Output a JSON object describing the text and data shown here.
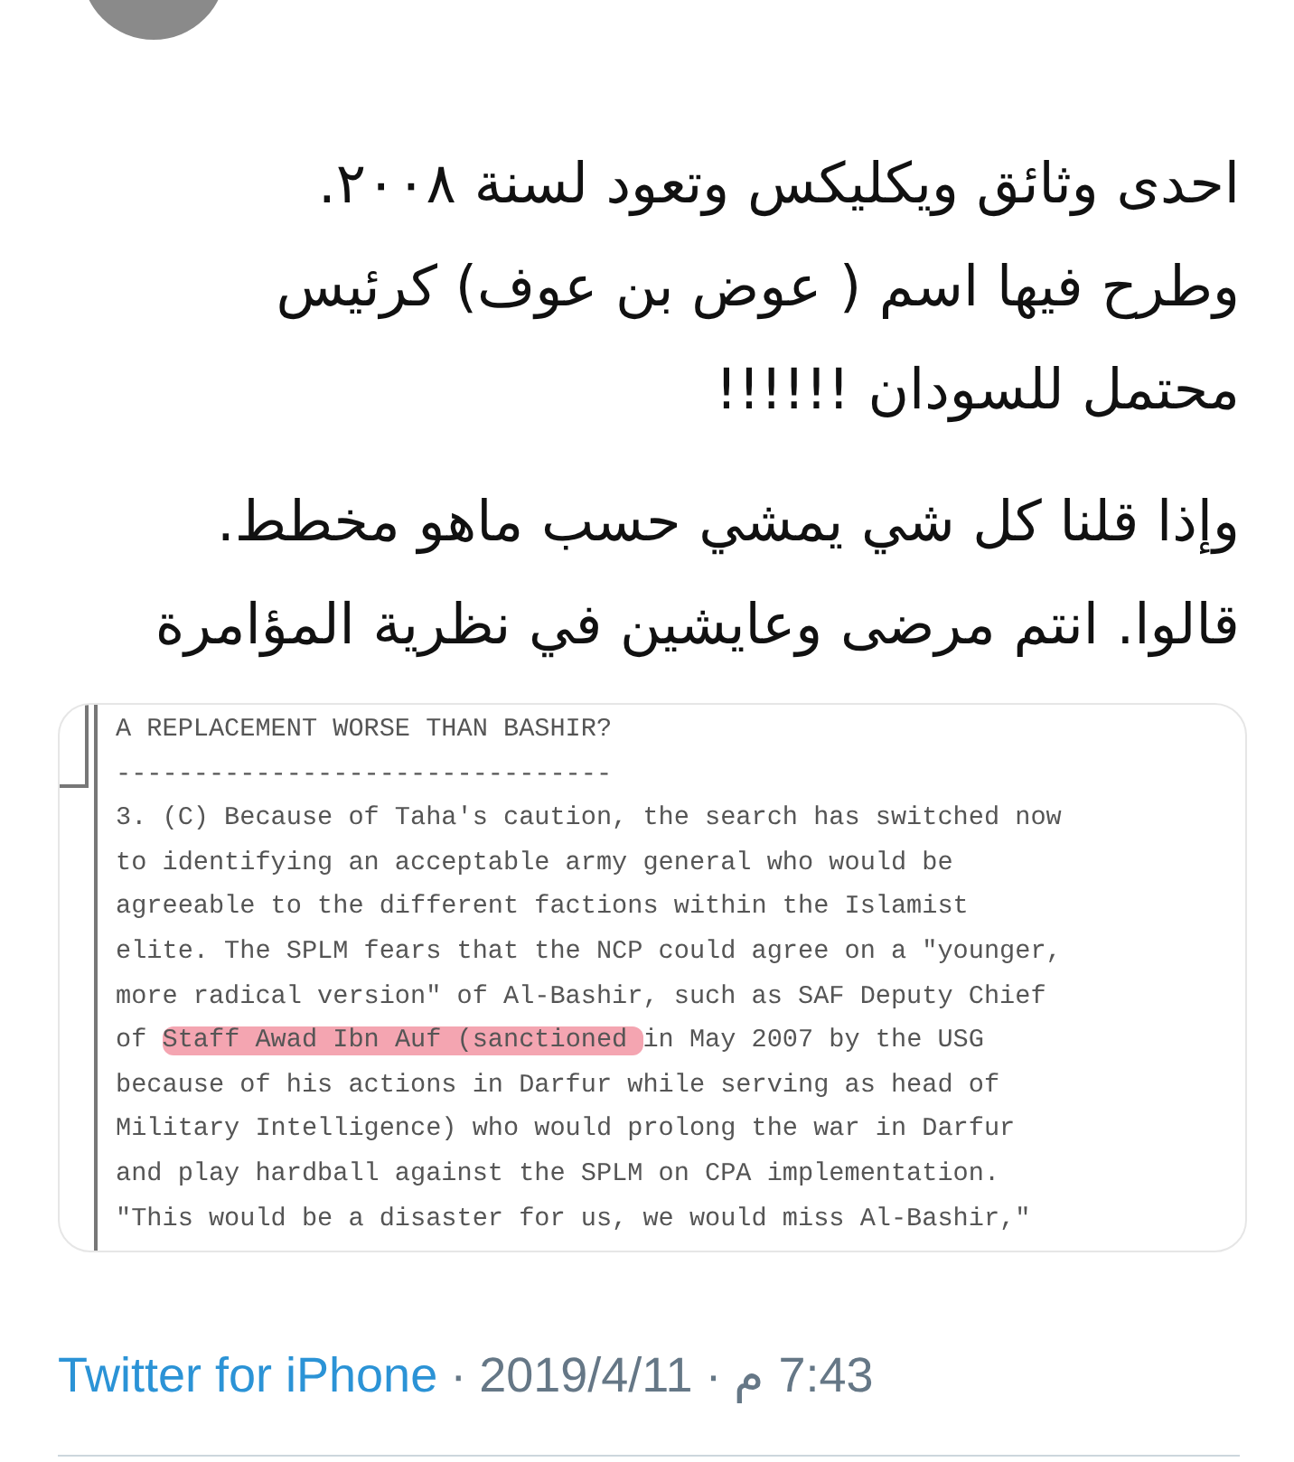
{
  "tweet": {
    "paragraphs": [
      [
        "احدى وثائق ويكليكس وتعود لسنة ٢٠٠٨.",
        "وطرح فيها اسم ( عوض بن عوف) كرئيس",
        "محتمل للسودان !!!!!!"
      ],
      [
        "وإذا قلنا كل شي يمشي حسب ماهو مخطط.",
        "قالوا. انتم مرضى وعايشين في نظرية المؤامرة"
      ]
    ]
  },
  "document": {
    "lines": [
      [
        {
          "text": "A REPLACEMENT WORSE THAN BASHIR?",
          "highlighted": false
        }
      ],
      [
        {
          "text": "--------------------------------",
          "highlighted": false
        }
      ],
      [
        {
          "text": "3. (C) Because of Taha's caution, the search has switched now",
          "highlighted": false
        }
      ],
      [
        {
          "text": "to identifying an acceptable army general who would be",
          "highlighted": false
        }
      ],
      [
        {
          "text": "agreeable to the different factions within the Islamist",
          "highlighted": false
        }
      ],
      [
        {
          "text": "elite. The SPLM fears that the NCP could agree on a \"younger,",
          "highlighted": false
        }
      ],
      [
        {
          "text": "more radical version\" of Al-Bashir, such as SAF Deputy Chief",
          "highlighted": false
        }
      ],
      [
        {
          "text": "of ",
          "highlighted": false
        },
        {
          "text": "Staff Awad Ibn Auf (sanctioned ",
          "highlighted": true
        },
        {
          "text": "in May 2007 by the USG",
          "highlighted": false
        }
      ],
      [
        {
          "text": "because of his actions in Darfur while serving as head of",
          "highlighted": false
        }
      ],
      [
        {
          "text": "Military Intelligence) who would prolong the war in Darfur",
          "highlighted": false
        }
      ],
      [
        {
          "text": "and play hardball against the SPLM on CPA implementation.",
          "highlighted": false
        }
      ],
      [
        {
          "text": "\"This would be a disaster for us, we would miss Al-Bashir,\"",
          "highlighted": false
        }
      ]
    ]
  },
  "footer": {
    "source": "Twitter for iPhone",
    "separator": "·",
    "date": "2019/4/11",
    "time": "7:43 م"
  }
}
